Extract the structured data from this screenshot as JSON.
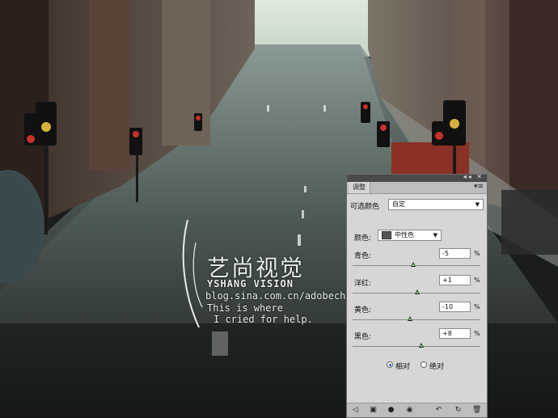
{
  "watermark": {
    "cn_title": "艺尚视觉",
    "en_title": "YSHANG VISION",
    "url": "blog.sina.com.cn/adobech",
    "line1": "This is where",
    "line2": "I cried for help."
  },
  "panel": {
    "tab_label": "调整",
    "preset_label": "可选颜色",
    "preset_value": "自定",
    "color_label": "颜色:",
    "color_value": "中性色",
    "sliders": [
      {
        "label": "青色:",
        "value": "-5",
        "unit": "%",
        "level": -5
      },
      {
        "label": "洋红:",
        "value": "+1",
        "unit": "%",
        "level": 1
      },
      {
        "label": "黄色:",
        "value": "-10",
        "unit": "%",
        "level": -10
      },
      {
        "label": "黑色:",
        "value": "+8",
        "unit": "%",
        "level": 8
      }
    ],
    "mode_relative": "相对",
    "mode_absolute": "绝对",
    "mode_selected": "relative",
    "icons": [
      "back-arrow-icon",
      "new-layer-icon",
      "mask-icon",
      "eye-icon",
      "previous-state-icon",
      "reset-icon",
      "delete-icon"
    ]
  }
}
